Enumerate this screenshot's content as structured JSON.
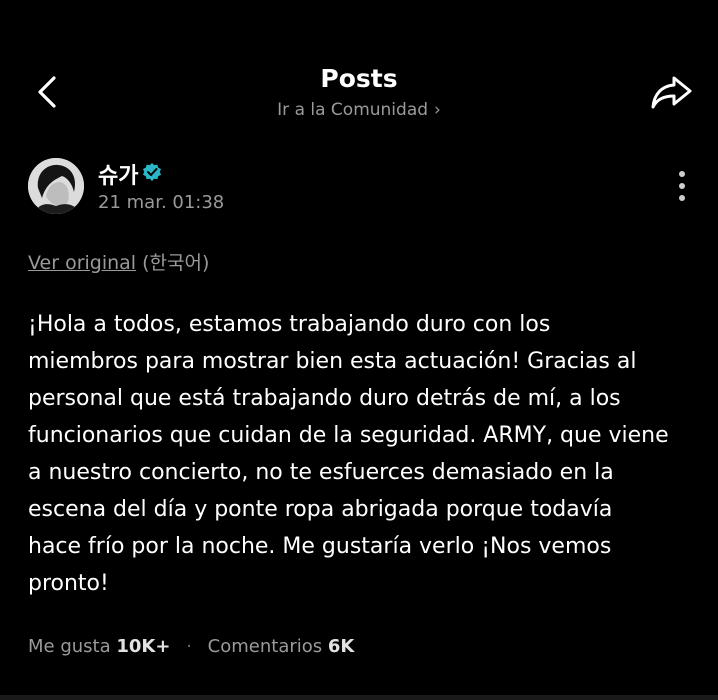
{
  "header": {
    "title": "Posts",
    "community_link": "Ir a la Comunidad",
    "back_icon": "chevron-left-icon",
    "share_icon": "share-arrow-icon"
  },
  "post": {
    "author": {
      "name": "슈가",
      "verified": true,
      "verified_color": "#2bb6c8"
    },
    "timestamp": "21 mar. 01:38",
    "translation": {
      "link_label": "Ver original",
      "language": "(한국어)"
    },
    "body_lines": [
      "¡Hola a todos, estamos trabajando duro con los",
      "miembros para mostrar bien esta actuación! Gracias al",
      "personal que está trabajando duro detrás de mí, a los",
      "funcionarios que cuidan de la seguridad. ARMY, que viene",
      "a nuestro concierto, no te esfuerces demasiado en la",
      "escena del día y ponte ropa abrigada porque todavía",
      "hace frío por la noche. Me gustaría verlo ¡Nos vemos",
      "pronto!"
    ]
  },
  "stats": {
    "likes_label": "Me gusta",
    "likes_count": "10K+",
    "separator": "·",
    "comments_label": "Comentarios",
    "comments_count": "6K"
  },
  "colors": {
    "background": "#000000",
    "text_primary": "#ffffff",
    "text_secondary": "#9a9a9a"
  }
}
